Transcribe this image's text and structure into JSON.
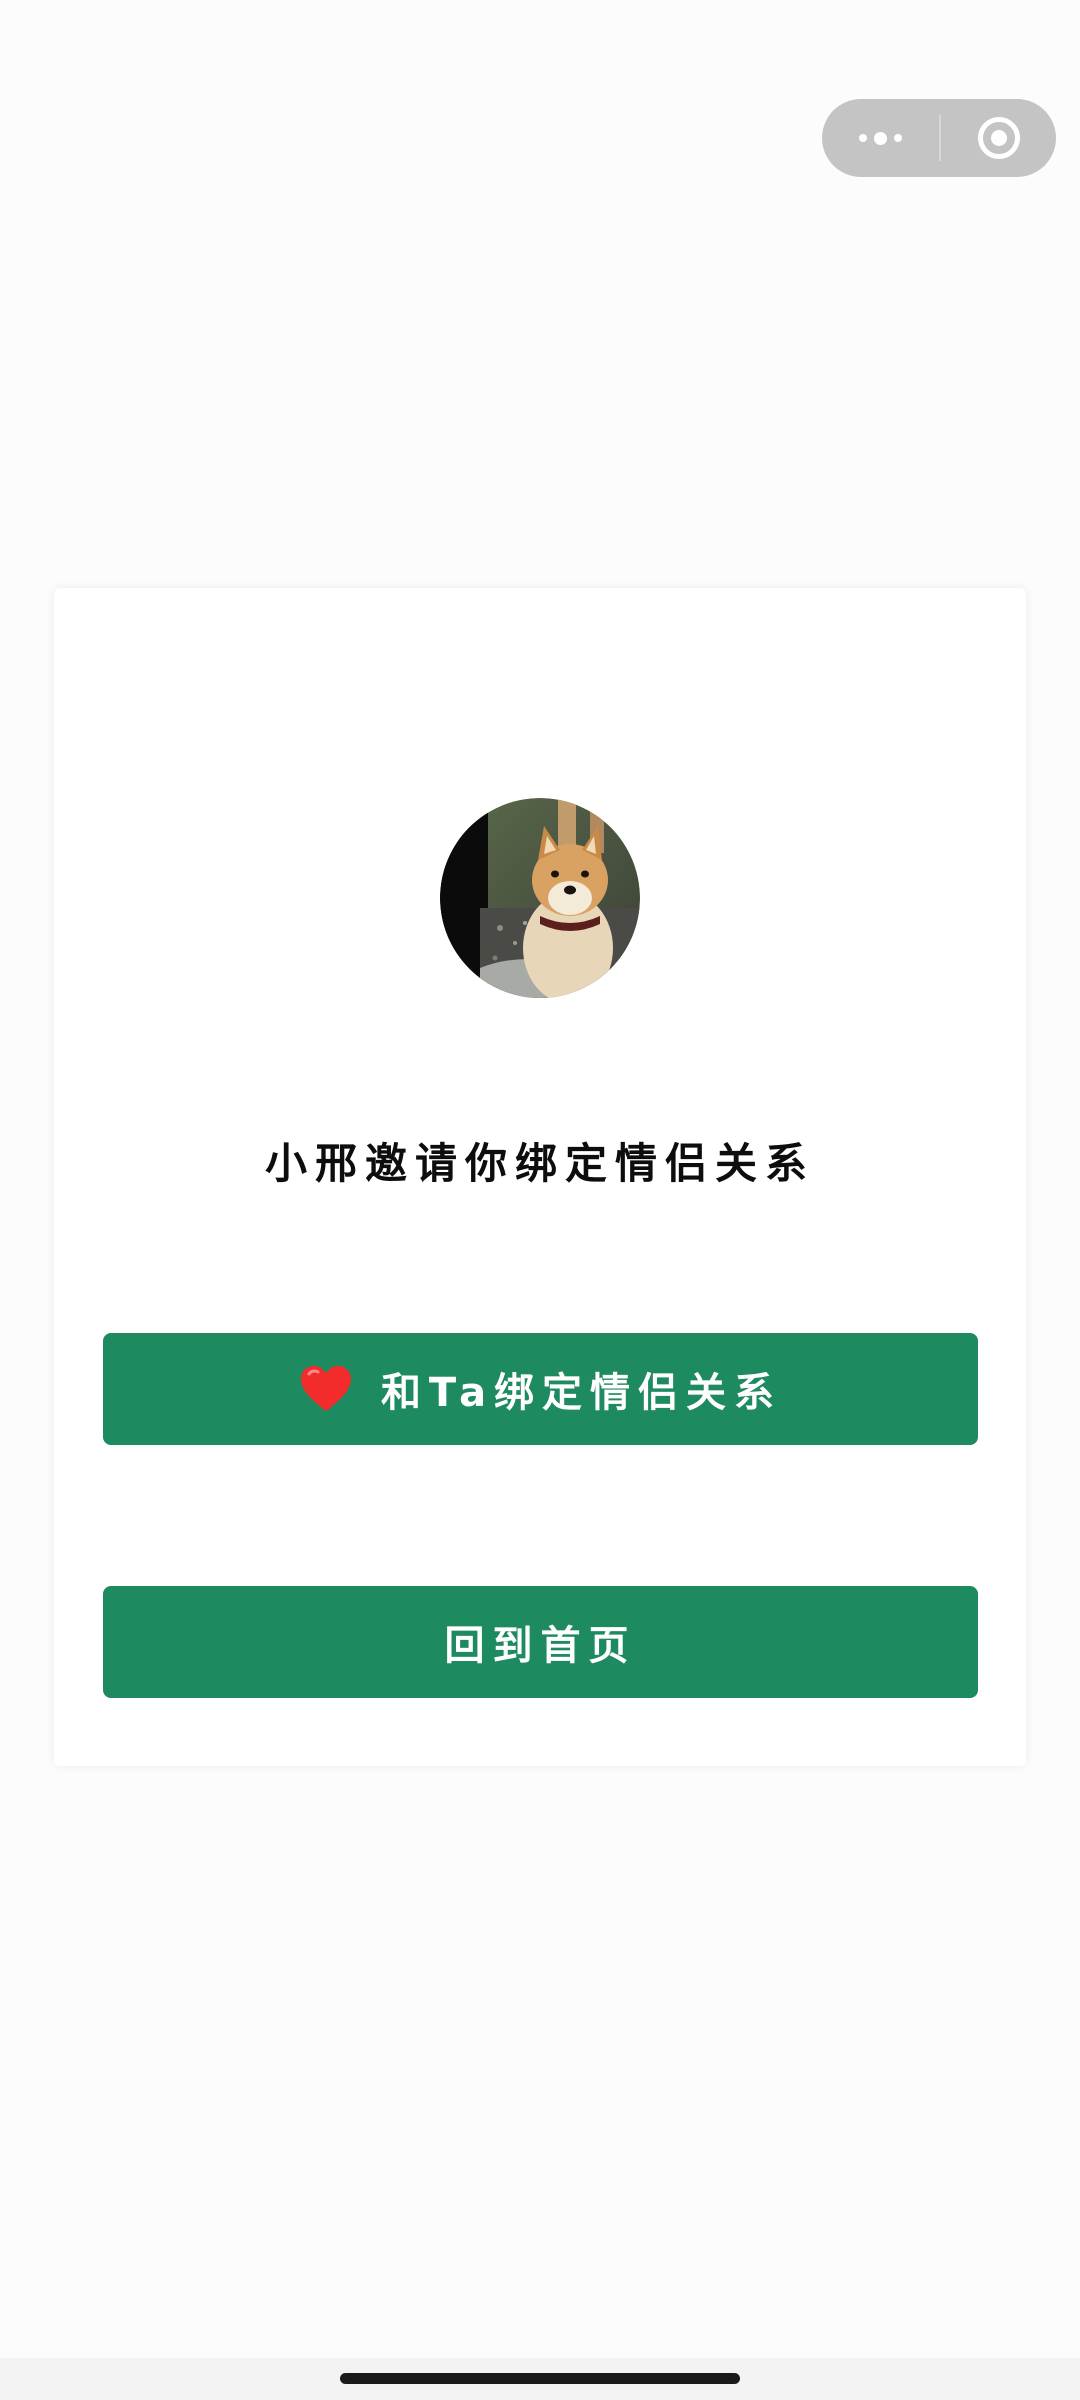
{
  "capsule": {
    "more_icon": "more-dots-icon",
    "close_icon": "target-circle-icon"
  },
  "card": {
    "avatar_description": "shiba-inu-avatar",
    "invite_text": "小邢邀请你绑定情侣关系",
    "bind_button": {
      "icon": "heart-icon",
      "label": "和Ta绑定情侣关系"
    },
    "home_button": {
      "label": "回到首页"
    }
  },
  "colors": {
    "primary_button": "#1e8a60",
    "heart": "#f22b2b",
    "capsule_bg": "#c4c4c4"
  }
}
